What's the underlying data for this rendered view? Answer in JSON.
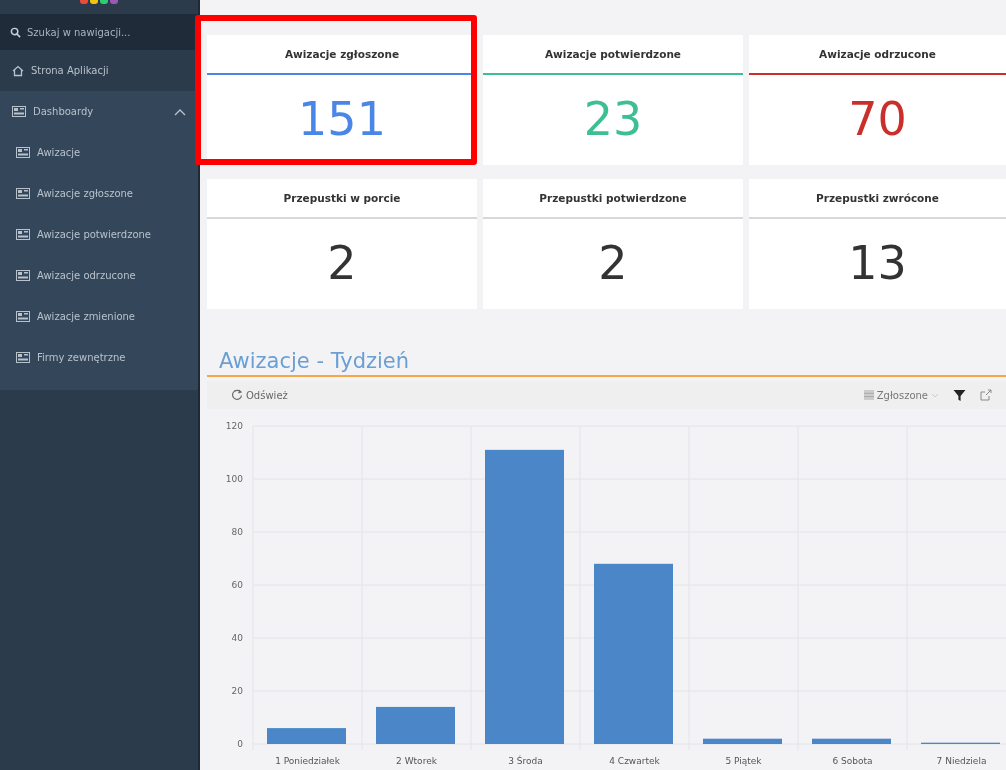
{
  "sidebar": {
    "search": {
      "placeholder": "Szukaj w nawigacji..."
    },
    "items": [
      {
        "label": "Strona Aplikacji",
        "kind": "home"
      },
      {
        "label": "Dashboardy",
        "kind": "group",
        "expanded": true,
        "children": [
          {
            "label": "Awizacje"
          },
          {
            "label": "Awizacje zgłoszone"
          },
          {
            "label": "Awizacje potwierdzone"
          },
          {
            "label": "Awizacje odrzucone"
          },
          {
            "label": "Awizacje zmienione"
          },
          {
            "label": "Firmy zewnętrzne"
          }
        ]
      }
    ]
  },
  "cards": [
    {
      "title": "Awizacje zgłoszone",
      "value": "151",
      "color": "#4a86e8",
      "highlighted": true
    },
    {
      "title": "Awizacje potwierdzone",
      "value": "23",
      "color": "#3cbf95",
      "highlighted": false
    },
    {
      "title": "Awizacje odrzucone",
      "value": "70",
      "color": "#c9302c",
      "highlighted": false
    },
    {
      "title": "Przepustki w porcie",
      "value": "2",
      "color": "#333333",
      "highlighted": false
    },
    {
      "title": "Przepustki potwierdzone",
      "value": "2",
      "color": "#333333",
      "highlighted": false
    },
    {
      "title": "Przepustki zwrócone",
      "value": "13",
      "color": "#333333",
      "highlighted": false
    }
  ],
  "section": {
    "title": "Awizacje - Tydzień",
    "toolbar": {
      "refresh": "Odśwież"
    },
    "chart_data": {
      "type": "bar",
      "categories": [
        "1 Poniedziałek",
        "2 Wtorek",
        "3 Środa",
        "4 Czwartek",
        "5 Piątek",
        "6 Sobota",
        "7 Niedziela"
      ],
      "series": [
        {
          "name": "Zgłoszone",
          "color": "#4a86c8",
          "values": [
            6,
            14,
            111,
            68,
            2,
            2,
            0.5
          ]
        }
      ],
      "ylim": [
        0,
        120
      ],
      "yticks": [
        0,
        20,
        40,
        60,
        80,
        100,
        120
      ],
      "grid": true
    }
  }
}
